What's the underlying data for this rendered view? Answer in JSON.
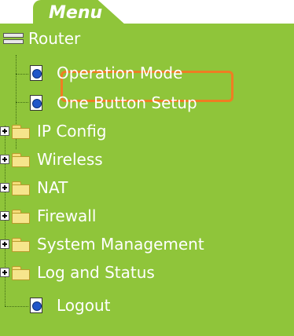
{
  "menu": {
    "title": "Menu"
  },
  "tree": {
    "root": "Router",
    "items": [
      {
        "label": "Operation Mode",
        "type": "page",
        "selected": true
      },
      {
        "label": "One Button Setup",
        "type": "page"
      },
      {
        "label": "IP Config",
        "type": "folder"
      },
      {
        "label": "Wireless",
        "type": "folder"
      },
      {
        "label": "NAT",
        "type": "folder"
      },
      {
        "label": "Firewall",
        "type": "folder"
      },
      {
        "label": "System Management",
        "type": "folder"
      },
      {
        "label": "Log and Status",
        "type": "folder"
      },
      {
        "label": "Logout",
        "type": "page"
      }
    ]
  },
  "colors": {
    "panel": "#8fc53a",
    "selection": "#ef7d22",
    "text": "#ffffff"
  }
}
